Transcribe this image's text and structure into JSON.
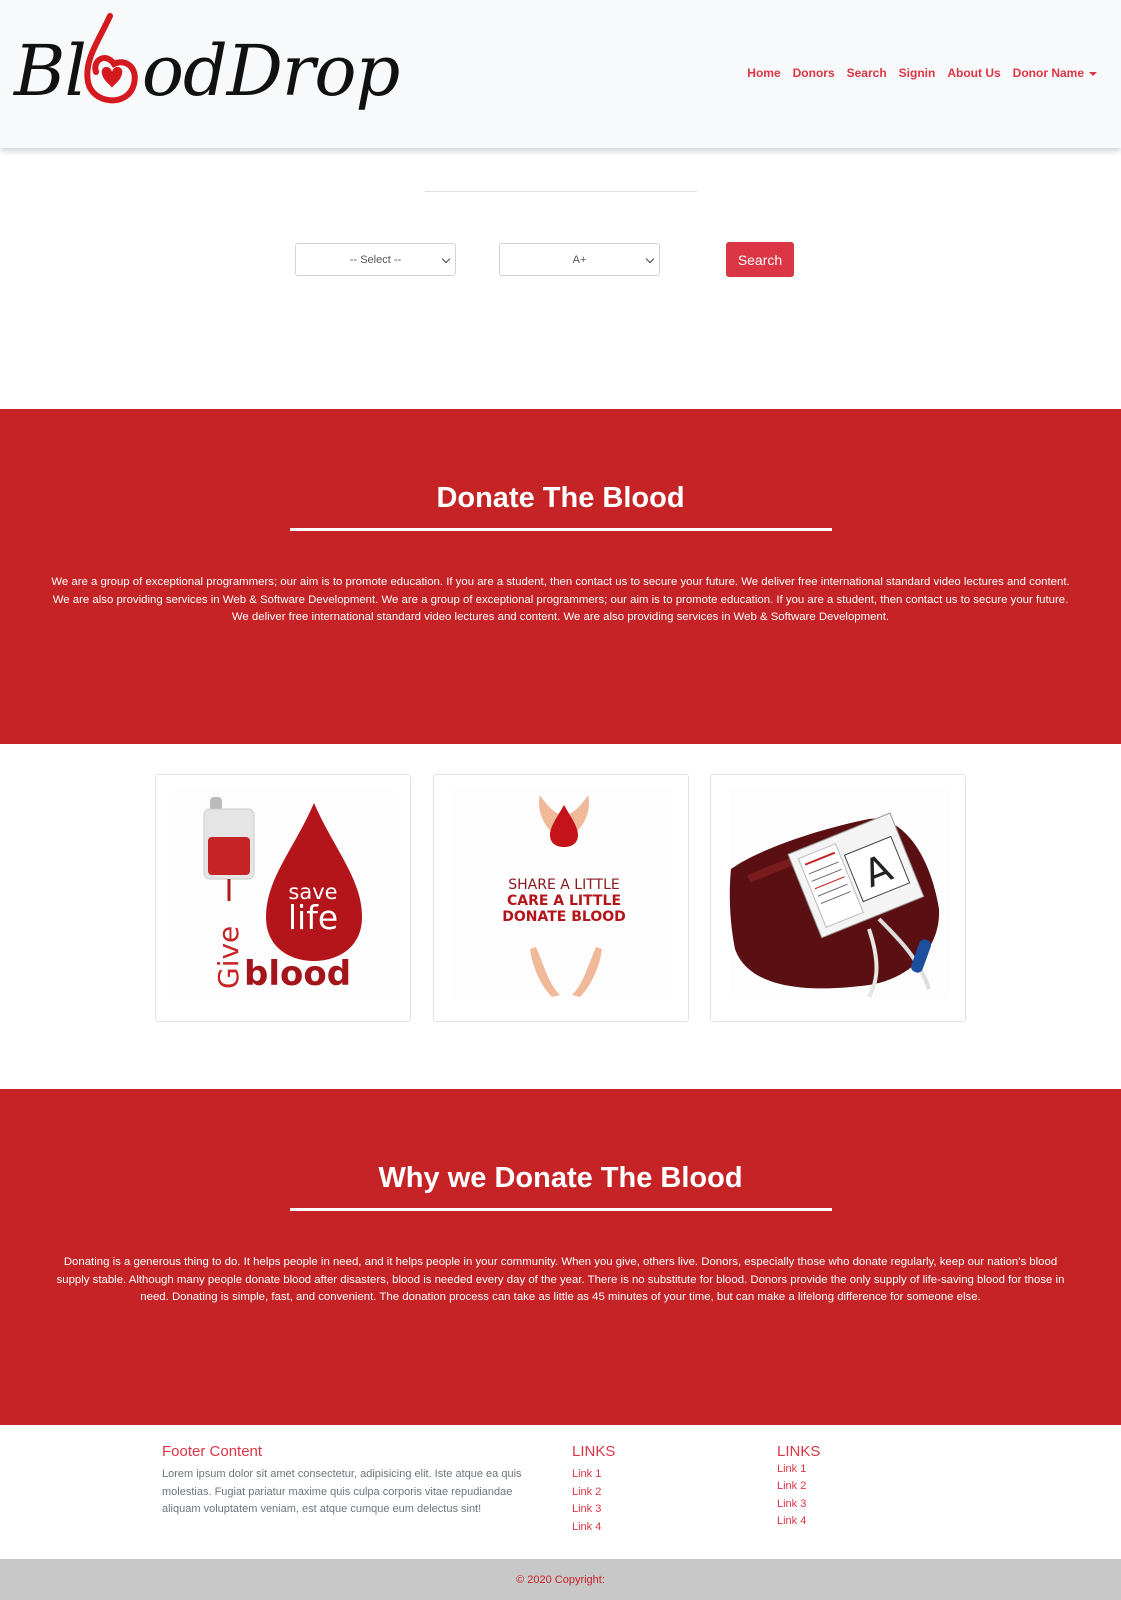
{
  "brand": {
    "logo_text": "BloodDrop",
    "logo_prefix": "Bl",
    "logo_suffix": "odDrop"
  },
  "nav": {
    "items": [
      {
        "label": "Home"
      },
      {
        "label": "Donors"
      },
      {
        "label": "Search"
      },
      {
        "label": "Signin"
      },
      {
        "label": "About Us"
      },
      {
        "label": "Donor Name"
      }
    ]
  },
  "search": {
    "city_select": "-- Select --",
    "blood_group_select": "A+",
    "button_label": "Search"
  },
  "donate_section": {
    "title": "Donate The Blood",
    "text": "We are a group of exceptional programmers; our aim is to promote education. If you are a student, then contact us to secure your future. We deliver free international standard video lectures and content. We are also providing services in Web & Software Development. We are a group of exceptional programmers; our aim is to promote education. If you are a student, then contact us to secure your future. We deliver free international standard video lectures and content. We are also providing services in Web & Software Development."
  },
  "cards": [
    {
      "line1": "save",
      "line2": "life",
      "word_give": "Give",
      "word_blood": "blood"
    },
    {
      "line1": "SHARE A LITTLE",
      "line2": "CARE A LITTLE",
      "line3": "DONATE BLOOD"
    },
    {
      "group_letter": "A"
    }
  ],
  "why_section": {
    "title": "Why we Donate The Blood",
    "text": "Donating is a generous thing to do. It helps people in need, and it helps people in your community. When you give, others live. Donors, especially those who donate regularly, keep our nation's blood supply stable. Although many people donate blood after disasters, blood is needed every day of the year. There is no substitute for blood. Donors provide the only supply of life-saving blood for those in need. Donating is simple, fast, and convenient. The donation process can take as little as 45 minutes of your time, but can make a lifelong difference for someone else."
  },
  "footer": {
    "title": "Footer Content",
    "text": "Lorem ipsum dolor sit amet consectetur, adipisicing elit. Iste atque ea quis molestias. Fugiat pariatur maxime quis culpa corporis vitae repudiandae aliquam voluptatem veniam, est atque cumque eum delectus sint!",
    "links_col1_title": "LINKS",
    "links_col1": [
      "Link 1",
      "Link 2",
      "Link 3",
      "Link 4"
    ],
    "links_col2_title": "LINKS",
    "links_col2": [
      "Link 1",
      "Link 2",
      "Link 3",
      "Link 4"
    ],
    "copyright": "© 2020 Copyright:"
  },
  "colors": {
    "primary_red": "#dc3545",
    "section_red": "#c62326",
    "navbar_bg": "#f8f9fa",
    "copyright_bg": "#c8c8c8"
  }
}
